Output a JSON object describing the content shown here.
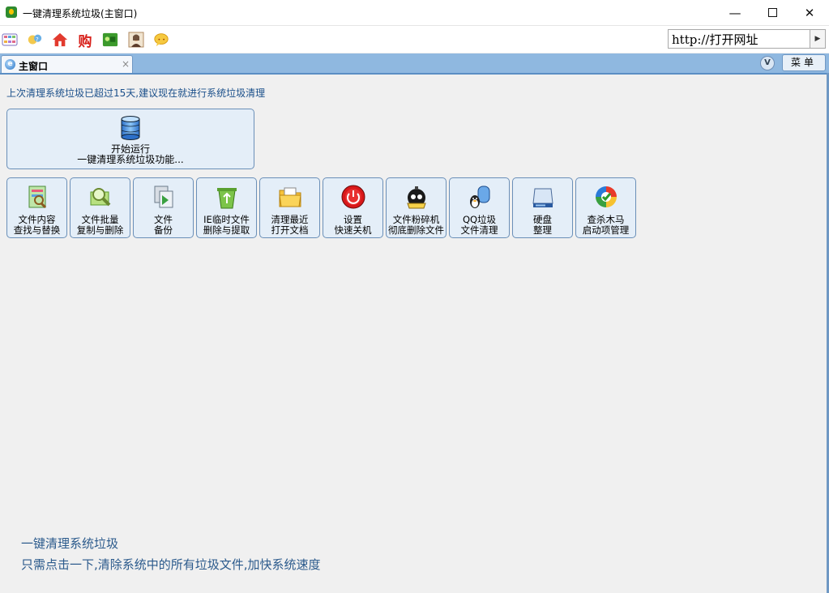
{
  "window": {
    "title": "一键清理系统垃圾(主窗口)",
    "min_label": "—",
    "max_label": "",
    "close_label": "✕"
  },
  "toolbar": {
    "icons": [
      "menu-grid-icon",
      "user-help-icon",
      "home-icon",
      "shopping-icon",
      "game-icon",
      "photo-icon",
      "chat-bubble-icon"
    ],
    "url_placeholder": "http://打开网址",
    "go_label": "▶"
  },
  "tabbar": {
    "tab_label": "主窗口",
    "tab_close": "×",
    "v_label": "V",
    "menu_label": "菜单"
  },
  "main": {
    "notice": "上次清理系统垃圾已超过15天,建议现在就进行系统垃圾清理",
    "start_button": {
      "line1": "开始运行",
      "line2": "一键清理系统垃圾功能..."
    },
    "tools": [
      {
        "line1": "文件内容",
        "line2": "查找与替换",
        "icon": "document-search-icon"
      },
      {
        "line1": "文件批量",
        "line2": "复制与删除",
        "icon": "magnifier-batch-icon"
      },
      {
        "line1": "文件",
        "line2": "备份",
        "icon": "file-backup-icon"
      },
      {
        "line1": "IE临时文件",
        "line2": "删除与提取",
        "icon": "recycle-bin-icon"
      },
      {
        "line1": "清理最近",
        "line2": "打开文档",
        "icon": "folder-icon"
      },
      {
        "line1": "设置",
        "line2": "快速关机",
        "icon": "power-icon"
      },
      {
        "line1": "文件粉碎机",
        "line2": "彻底删除文件",
        "icon": "shredder-bomb-icon"
      },
      {
        "line1": "QQ垃圾",
        "line2": "文件清理",
        "icon": "qq-penguin-icon"
      },
      {
        "line1": "硬盘",
        "line2": "整理",
        "icon": "hard-disk-icon"
      },
      {
        "line1": "查杀木马",
        "line2": "启动项管理",
        "icon": "shield-check-icon"
      }
    ]
  },
  "footer": {
    "title": "一键清理系统垃圾",
    "description": "只需点击一下,清除系统中的所有垃圾文件,加快系统速度"
  },
  "colors": {
    "tab_bar": "#8fb8e0",
    "button_bg": "#e4eef8",
    "button_border": "#6a8fb8",
    "info_text": "#2b5a8c"
  }
}
